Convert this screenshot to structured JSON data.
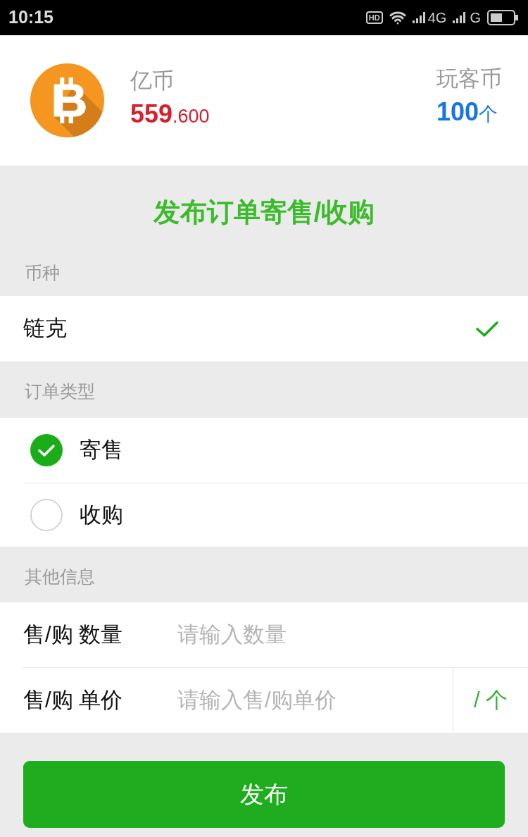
{
  "status_bar": {
    "time": "10:15",
    "badge": "HD",
    "network_1": "4G",
    "network_2": "G"
  },
  "wallet": {
    "left": {
      "label": "亿币",
      "amount": "559",
      "amount_fraction": ".600"
    },
    "right": {
      "label": "玩客币",
      "amount": "100",
      "unit": "个"
    }
  },
  "form": {
    "title": "发布订单寄售/收购",
    "sections": [
      {
        "label": "币种",
        "kind": "choice",
        "options": [
          {
            "label": "链克",
            "selected": true
          }
        ]
      },
      {
        "label": "订单类型",
        "kind": "radio",
        "options": [
          {
            "label": "寄售",
            "selected": true
          },
          {
            "label": "收购",
            "selected": false
          }
        ]
      },
      {
        "label": "其他信息",
        "kind": "fields",
        "fields": [
          {
            "label": "售/购 数量",
            "placeholder": "请输入数量"
          },
          {
            "label": "售/购 单价",
            "placeholder": "请输入售/购单价",
            "unit": "/ 个"
          }
        ]
      }
    ],
    "submit": "发布"
  }
}
